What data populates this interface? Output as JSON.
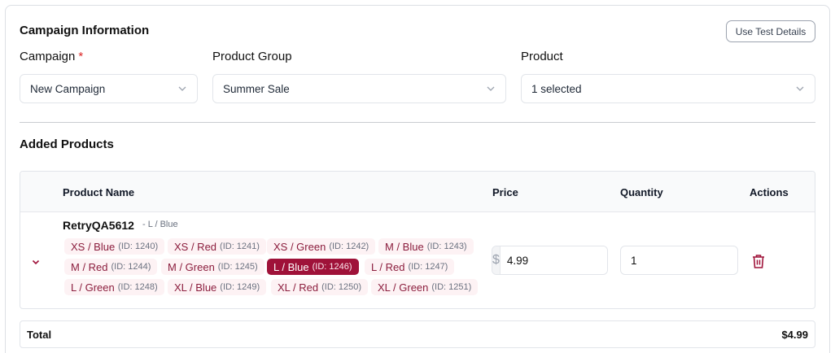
{
  "section": {
    "title": "Campaign Information",
    "test_button": "Use Test Details"
  },
  "fields": {
    "campaign": {
      "label": "Campaign",
      "required_mark": "*",
      "value": "New Campaign"
    },
    "product_group": {
      "label": "Product Group",
      "value": "Summer Sale"
    },
    "product": {
      "label": "Product",
      "value": "1 selected"
    }
  },
  "added_products": {
    "title": "Added Products",
    "columns": {
      "name": "Product Name",
      "price": "Price",
      "quantity": "Quantity",
      "actions": "Actions"
    },
    "row": {
      "name": "RetryQA5612",
      "variant": "- L / Blue",
      "currency_symbol": "$",
      "price": "4.99",
      "quantity": "1",
      "variants": [
        {
          "label": "XS / Blue",
          "id": "(ID: 1240)",
          "selected": false
        },
        {
          "label": "XS / Red",
          "id": "(ID: 1241)",
          "selected": false
        },
        {
          "label": "XS / Green",
          "id": "(ID: 1242)",
          "selected": false
        },
        {
          "label": "M / Blue",
          "id": "(ID: 1243)",
          "selected": false
        },
        {
          "label": "M / Red",
          "id": "(ID: 1244)",
          "selected": false
        },
        {
          "label": "M / Green",
          "id": "(ID: 1245)",
          "selected": false
        },
        {
          "label": "L / Blue",
          "id": "(ID: 1246)",
          "selected": true
        },
        {
          "label": "L / Red",
          "id": "(ID: 1247)",
          "selected": false
        },
        {
          "label": "L / Green",
          "id": "(ID: 1248)",
          "selected": false
        },
        {
          "label": "XL / Blue",
          "id": "(ID: 1249)",
          "selected": false
        },
        {
          "label": "XL / Red",
          "id": "(ID: 1250)",
          "selected": false
        },
        {
          "label": "XL / Green",
          "id": "(ID: 1251)",
          "selected": false
        }
      ]
    }
  },
  "total": {
    "label": "Total",
    "value": "$4.99"
  },
  "colors": {
    "accent": "#9f1239",
    "chip_bg": "#fdf2f4",
    "chip_text": "#8b1d3d",
    "required": "#dc2626"
  }
}
